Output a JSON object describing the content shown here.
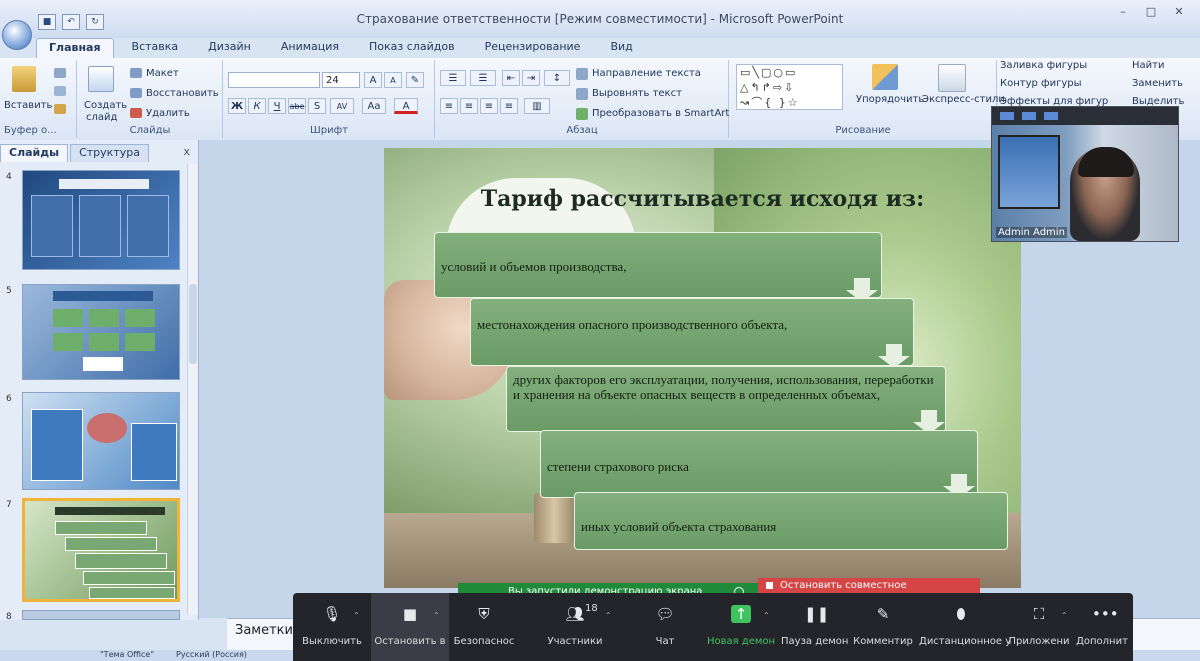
{
  "window": {
    "title": "Страхование ответственности [Режим совместимости] - Microsoft PowerPoint",
    "controls": [
      "–",
      "□",
      "✕"
    ]
  },
  "ribbon": {
    "tabs": [
      "Главная",
      "Вставка",
      "Дизайн",
      "Анимация",
      "Показ слайдов",
      "Рецензирование",
      "Вид"
    ],
    "active_tab": "Главная",
    "clipboard": {
      "paste": "Вставить",
      "label": "Буфер о..."
    },
    "slides": {
      "create_line1": "Создать",
      "create_line2": "слайд",
      "layout": "Макет",
      "reset": "Восстановить",
      "delete": "Удалить",
      "label": "Слайды"
    },
    "font": {
      "name_value": "",
      "size_value": "24",
      "grow": "A",
      "shrink": "A",
      "bold": "Ж",
      "italic": "К",
      "underline": "Ч",
      "strike": "abe",
      "shadow": "S",
      "spacing": "AV",
      "case": "Aa",
      "color": "A",
      "label": "Шрифт"
    },
    "paragraph": {
      "direction": "Направление текста",
      "align_text": "Выровнять текст",
      "smartart": "Преобразовать в SmartArt",
      "label": "Абзац"
    },
    "drawing": {
      "arrange": "Упорядочить",
      "quick_styles": "Экспресс-стили",
      "fill": "Заливка фигуры",
      "outline": "Контур фигуры",
      "effects": "Эффекты для фигур",
      "label": "Рисование"
    },
    "editing": {
      "find": "Найти",
      "replace": "Заменить",
      "select": "Выделить"
    }
  },
  "slide_panel": {
    "tabs": [
      "Слайды",
      "Структура"
    ],
    "close": "x",
    "thumbs": [
      {
        "num": "4",
        "bg": "#2f5f9e"
      },
      {
        "num": "5",
        "bg": "#4f7fb8"
      },
      {
        "num": "6",
        "bg": "#3c78b8"
      },
      {
        "num": "7",
        "bg": "#7fa96a",
        "selected": true
      },
      {
        "num": "8",
        "bg": "#b9cbe3"
      }
    ]
  },
  "slide": {
    "title": "Тариф рассчитывается исходя из:",
    "items": [
      "условий и объемов  производства,",
      "местонахождения  опасного производственного объекта,",
      "других факторов его эксплуатации, получения, использования, переработки и  хранения на объекте опасных веществ в определенных объемах,",
      "степени страхового риска",
      "иных условий объекта страхования"
    ]
  },
  "notes": {
    "label": "Заметки"
  },
  "status": {
    "lang": "Русский (Россия)",
    "theme": "\"Тема Office\""
  },
  "webcam": {
    "name": "Admin Admin"
  },
  "zoom": {
    "share_banner": "Вы запустили демонстрацию экрана",
    "stop_share": "Остановить совместное использование",
    "participants_count": "18",
    "buttons": [
      {
        "id": "mute",
        "label": "Выключить",
        "icon": "mic-icon"
      },
      {
        "id": "video",
        "label": "Остановить в",
        "icon": "video-icon"
      },
      {
        "id": "security",
        "label": "Безопаснос",
        "icon": "shield-icon"
      },
      {
        "id": "participants",
        "label": "Участники",
        "icon": "people-icon"
      },
      {
        "id": "chat",
        "label": "Чат",
        "icon": "chat-icon"
      },
      {
        "id": "share",
        "label": "Новая демон",
        "icon": "share-icon"
      },
      {
        "id": "pause",
        "label": "Пауза демон",
        "icon": "pause-icon"
      },
      {
        "id": "annotate",
        "label": "Комментир",
        "icon": "pen-icon"
      },
      {
        "id": "remote",
        "label": "Дистанционное у",
        "icon": "remote-icon"
      },
      {
        "id": "apps",
        "label": "Приложени",
        "icon": "apps-icon"
      },
      {
        "id": "more",
        "label": "Дополнит",
        "icon": "more-icon"
      }
    ]
  },
  "colors": {
    "zoom_green": "#3fc35f",
    "stop_red": "#d64545",
    "box_green": "#74a56f"
  }
}
